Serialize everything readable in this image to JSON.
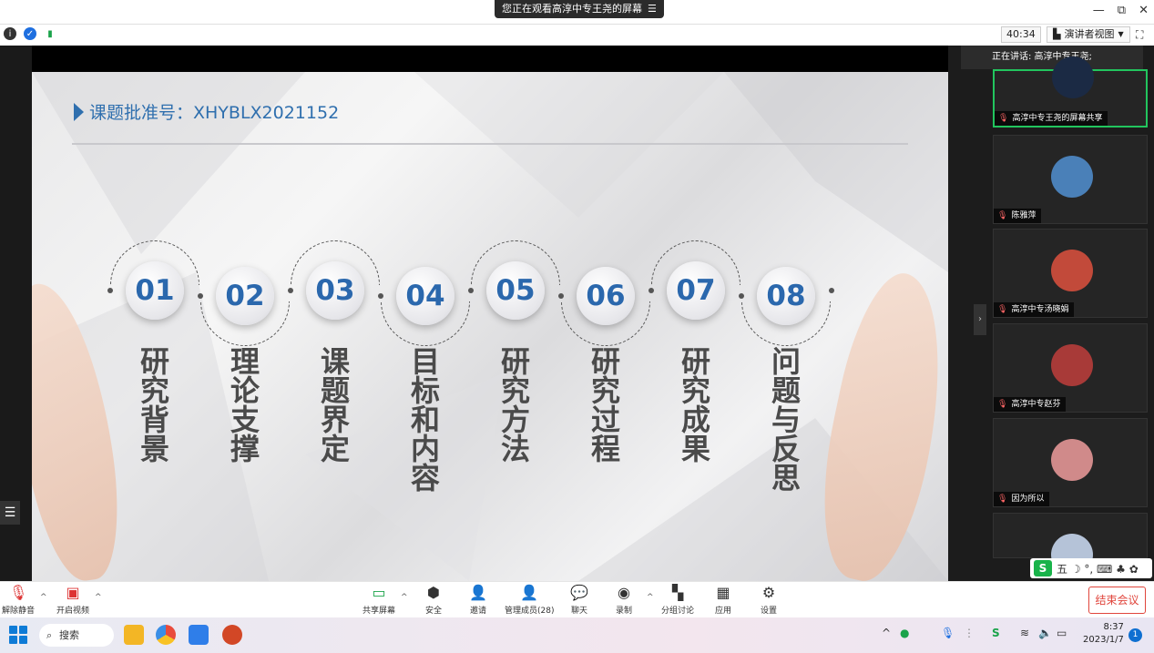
{
  "app": {
    "viewing_banner": "您正在观看高淳中专王尧的屏幕",
    "timer": "40:34",
    "view_mode": "演讲者视图"
  },
  "slide": {
    "title": "课题批准号：XHYBLX2021152",
    "items": [
      {
        "num": "01",
        "label": "研究背景"
      },
      {
        "num": "02",
        "label": "理论支撑"
      },
      {
        "num": "03",
        "label": "课题界定"
      },
      {
        "num": "04",
        "label": "目标和内容"
      },
      {
        "num": "05",
        "label": "研究方法"
      },
      {
        "num": "06",
        "label": "研究过程"
      },
      {
        "num": "07",
        "label": "研究成果"
      },
      {
        "num": "08",
        "label": "问题与反思"
      }
    ],
    "accent": "#2f6fae"
  },
  "sidebar": {
    "speaking": "正在讲话: 高淳中专王尧;",
    "participants": [
      {
        "name": "高淳中专王尧的屏幕共享",
        "avatar_color": "#1b2a44"
      },
      {
        "name": "陈雅萍",
        "avatar_color": "#4a80b8"
      },
      {
        "name": "高淳中专汤晓娟",
        "avatar_color": "#c24a3a"
      },
      {
        "name": "高淳中专赵芬",
        "avatar_color": "#a83a38"
      },
      {
        "name": "因为所以",
        "avatar_color": "#d08a8a"
      },
      {
        "name": "",
        "avatar_color": "#b5c3d8"
      }
    ]
  },
  "ime": {
    "s": "S",
    "mode": "五 ☽ °, ⌨ ♣ ✿"
  },
  "toolbar": {
    "unmute": "解除静音",
    "start_video": "开启视频",
    "share_screen": "共享屏幕",
    "security": "安全",
    "invite": "邀请",
    "manage_members": "管理成员(28)",
    "chat": "聊天",
    "record": "录制",
    "breakout": "分组讨论",
    "apps": "应用",
    "settings": "设置",
    "end_meeting": "结束会议"
  },
  "taskbar": {
    "search": "搜索",
    "time": "8:37",
    "date": "2023/1/7",
    "notifications": "1"
  }
}
